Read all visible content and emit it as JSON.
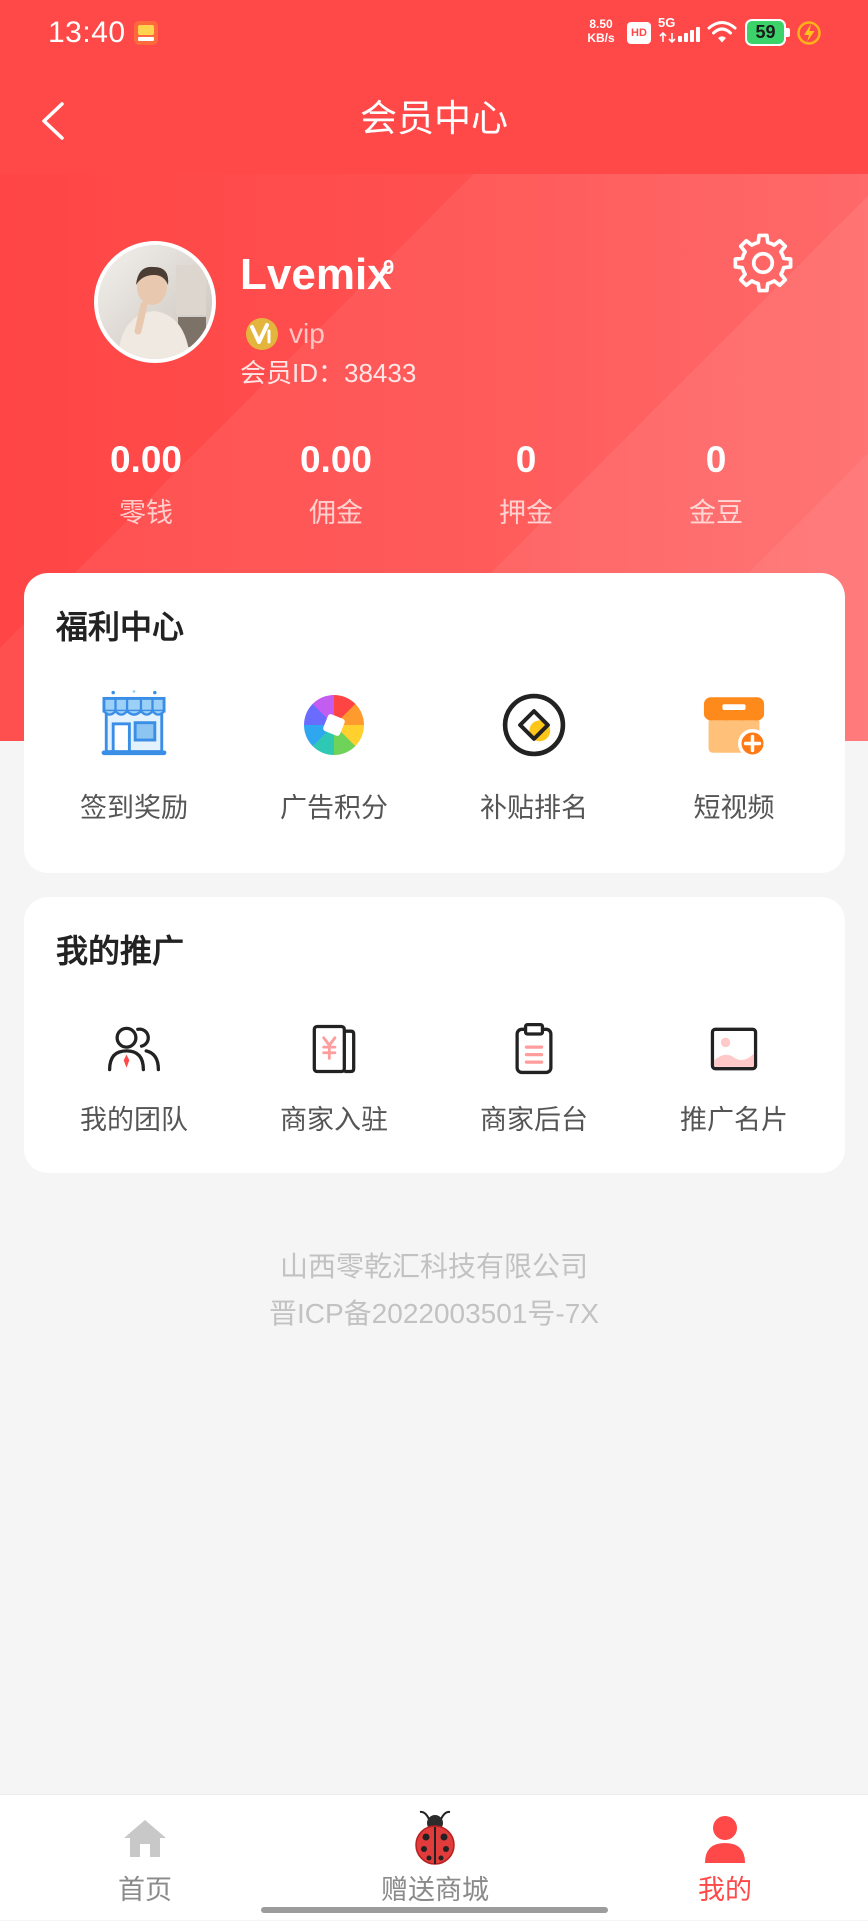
{
  "colors": {
    "primary": "#ff4848",
    "page_bg": "#f5f5f5",
    "card_bg": "#ffffff",
    "battery": "#3cd26a",
    "inactive_tab": "#8a8a8a"
  },
  "status_bar": {
    "time": "13:40",
    "notification_icon": "app-notification-icon",
    "net_speed_value": "8.50",
    "net_speed_unit": "KB/s",
    "hd": "HD",
    "network": "5G",
    "battery": "59",
    "charging_icon": "charging-bolt-icon"
  },
  "header": {
    "title": "会员中心",
    "back_icon": "back-arrow-icon"
  },
  "profile": {
    "name": "Lvemix",
    "name_badge": "9",
    "level": "vip",
    "member_id_label": "会员ID：",
    "member_id": "38433",
    "settings_icon": "gear-icon"
  },
  "stats": [
    {
      "value": "0.00",
      "label": "零钱"
    },
    {
      "value": "0.00",
      "label": "佣金"
    },
    {
      "value": "0",
      "label": "押金"
    },
    {
      "value": "0",
      "label": "金豆"
    }
  ],
  "welfare": {
    "title": "福利中心",
    "items": [
      {
        "label": "签到奖励",
        "icon": "store-icon"
      },
      {
        "label": "广告积分",
        "icon": "aperture-icon"
      },
      {
        "label": "补贴排名",
        "icon": "coin-icon"
      },
      {
        "label": "短视频",
        "icon": "shop-add-icon"
      }
    ]
  },
  "promotion": {
    "title": "我的推广",
    "items": [
      {
        "label": "我的团队",
        "icon": "team-icon"
      },
      {
        "label": "商家入驻",
        "icon": "merchant-doc-icon"
      },
      {
        "label": "商家后台",
        "icon": "clipboard-icon"
      },
      {
        "label": "推广名片",
        "icon": "picture-icon"
      }
    ]
  },
  "footer": {
    "company": "山西零乾汇科技有限公司",
    "icp": "晋ICP备2022003501号-7X"
  },
  "tab_bar": {
    "items": [
      {
        "label": "首页",
        "icon": "home-icon",
        "active": false
      },
      {
        "label": "赠送商城",
        "icon": "ladybug-icon",
        "active": false
      },
      {
        "label": "我的",
        "icon": "person-icon",
        "active": true
      }
    ]
  }
}
